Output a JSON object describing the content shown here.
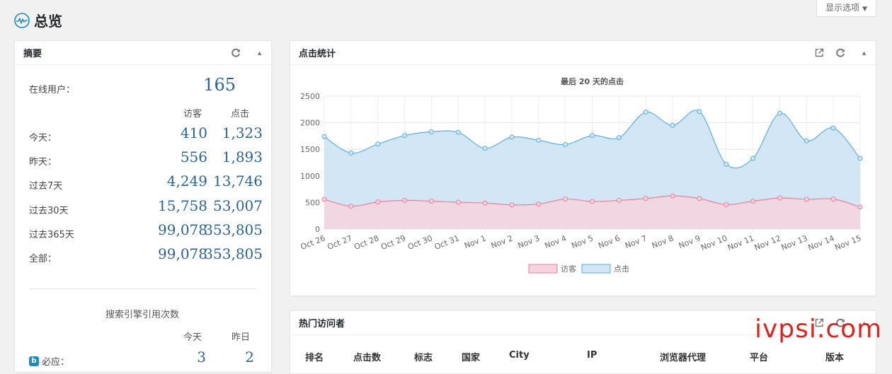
{
  "page": {
    "title": "总览",
    "screen_options": "显示选项"
  },
  "summary": {
    "title": "摘要",
    "online_label": "在线用户：",
    "online_value": "165",
    "col_visitors": "访客",
    "col_clicks": "点击",
    "rows": [
      {
        "label": "今天：",
        "visitors": "410",
        "clicks": "1,323"
      },
      {
        "label": "昨天：",
        "visitors": "556",
        "clicks": "1,893"
      },
      {
        "label": "过去7天",
        "visitors": "4,249",
        "clicks": "13,746"
      },
      {
        "label": "过去30天",
        "visitors": "15,758",
        "clicks": "53,007"
      },
      {
        "label": "过去365天",
        "visitors": "99,078",
        "clicks": "353,805"
      },
      {
        "label": "全部：",
        "visitors": "99,078",
        "clicks": "353,805"
      }
    ],
    "search_title": "搜索引擎引用次数",
    "col_today": "今天",
    "col_yesterday": "昨日",
    "search_rows": [
      {
        "label": "必应：",
        "today": "3",
        "yesterday": "2"
      }
    ]
  },
  "clicks_box": {
    "title": "点击统计"
  },
  "chart_data": {
    "type": "area",
    "title": "最后 20 天的点击",
    "x": [
      "Oct 26",
      "Oct 27",
      "Oct 28",
      "Oct 29",
      "Oct 30",
      "Oct 31",
      "Nov 1",
      "Nov 2",
      "Nov 3",
      "Nov 4",
      "Nov 5",
      "Nov 6",
      "Nov 7",
      "Nov 8",
      "Nov 9",
      "Nov 10",
      "Nov 11",
      "Nov 12",
      "Nov 13",
      "Nov 14",
      "Nov 15"
    ],
    "series": [
      {
        "name": "访客",
        "color": "#e6829a",
        "fill": "#f6d3de",
        "values": [
          560,
          430,
          510,
          540,
          525,
          505,
          490,
          455,
          470,
          565,
          520,
          540,
          575,
          625,
          575,
          460,
          525,
          585,
          560,
          565,
          415
        ]
      },
      {
        "name": "点击",
        "color": "#5aafde",
        "fill": "#d3e6f6",
        "values": [
          1740,
          1430,
          1600,
          1760,
          1830,
          1820,
          1520,
          1730,
          1670,
          1590,
          1760,
          1720,
          2200,
          1950,
          2210,
          1220,
          1330,
          2180,
          1660,
          1900,
          1330
        ]
      }
    ],
    "ylim": [
      0,
      2500
    ],
    "yticks": [
      0,
      500,
      1000,
      1500,
      2000,
      2500
    ],
    "legend": "bottom",
    "grid": true
  },
  "top_visitors": {
    "title": "热门访问者",
    "columns": [
      "排名",
      "点击数",
      "标志",
      "国家",
      "City",
      "IP",
      "浏览器代理",
      "平台",
      "版本"
    ]
  },
  "watermark": "ivpsi.com"
}
